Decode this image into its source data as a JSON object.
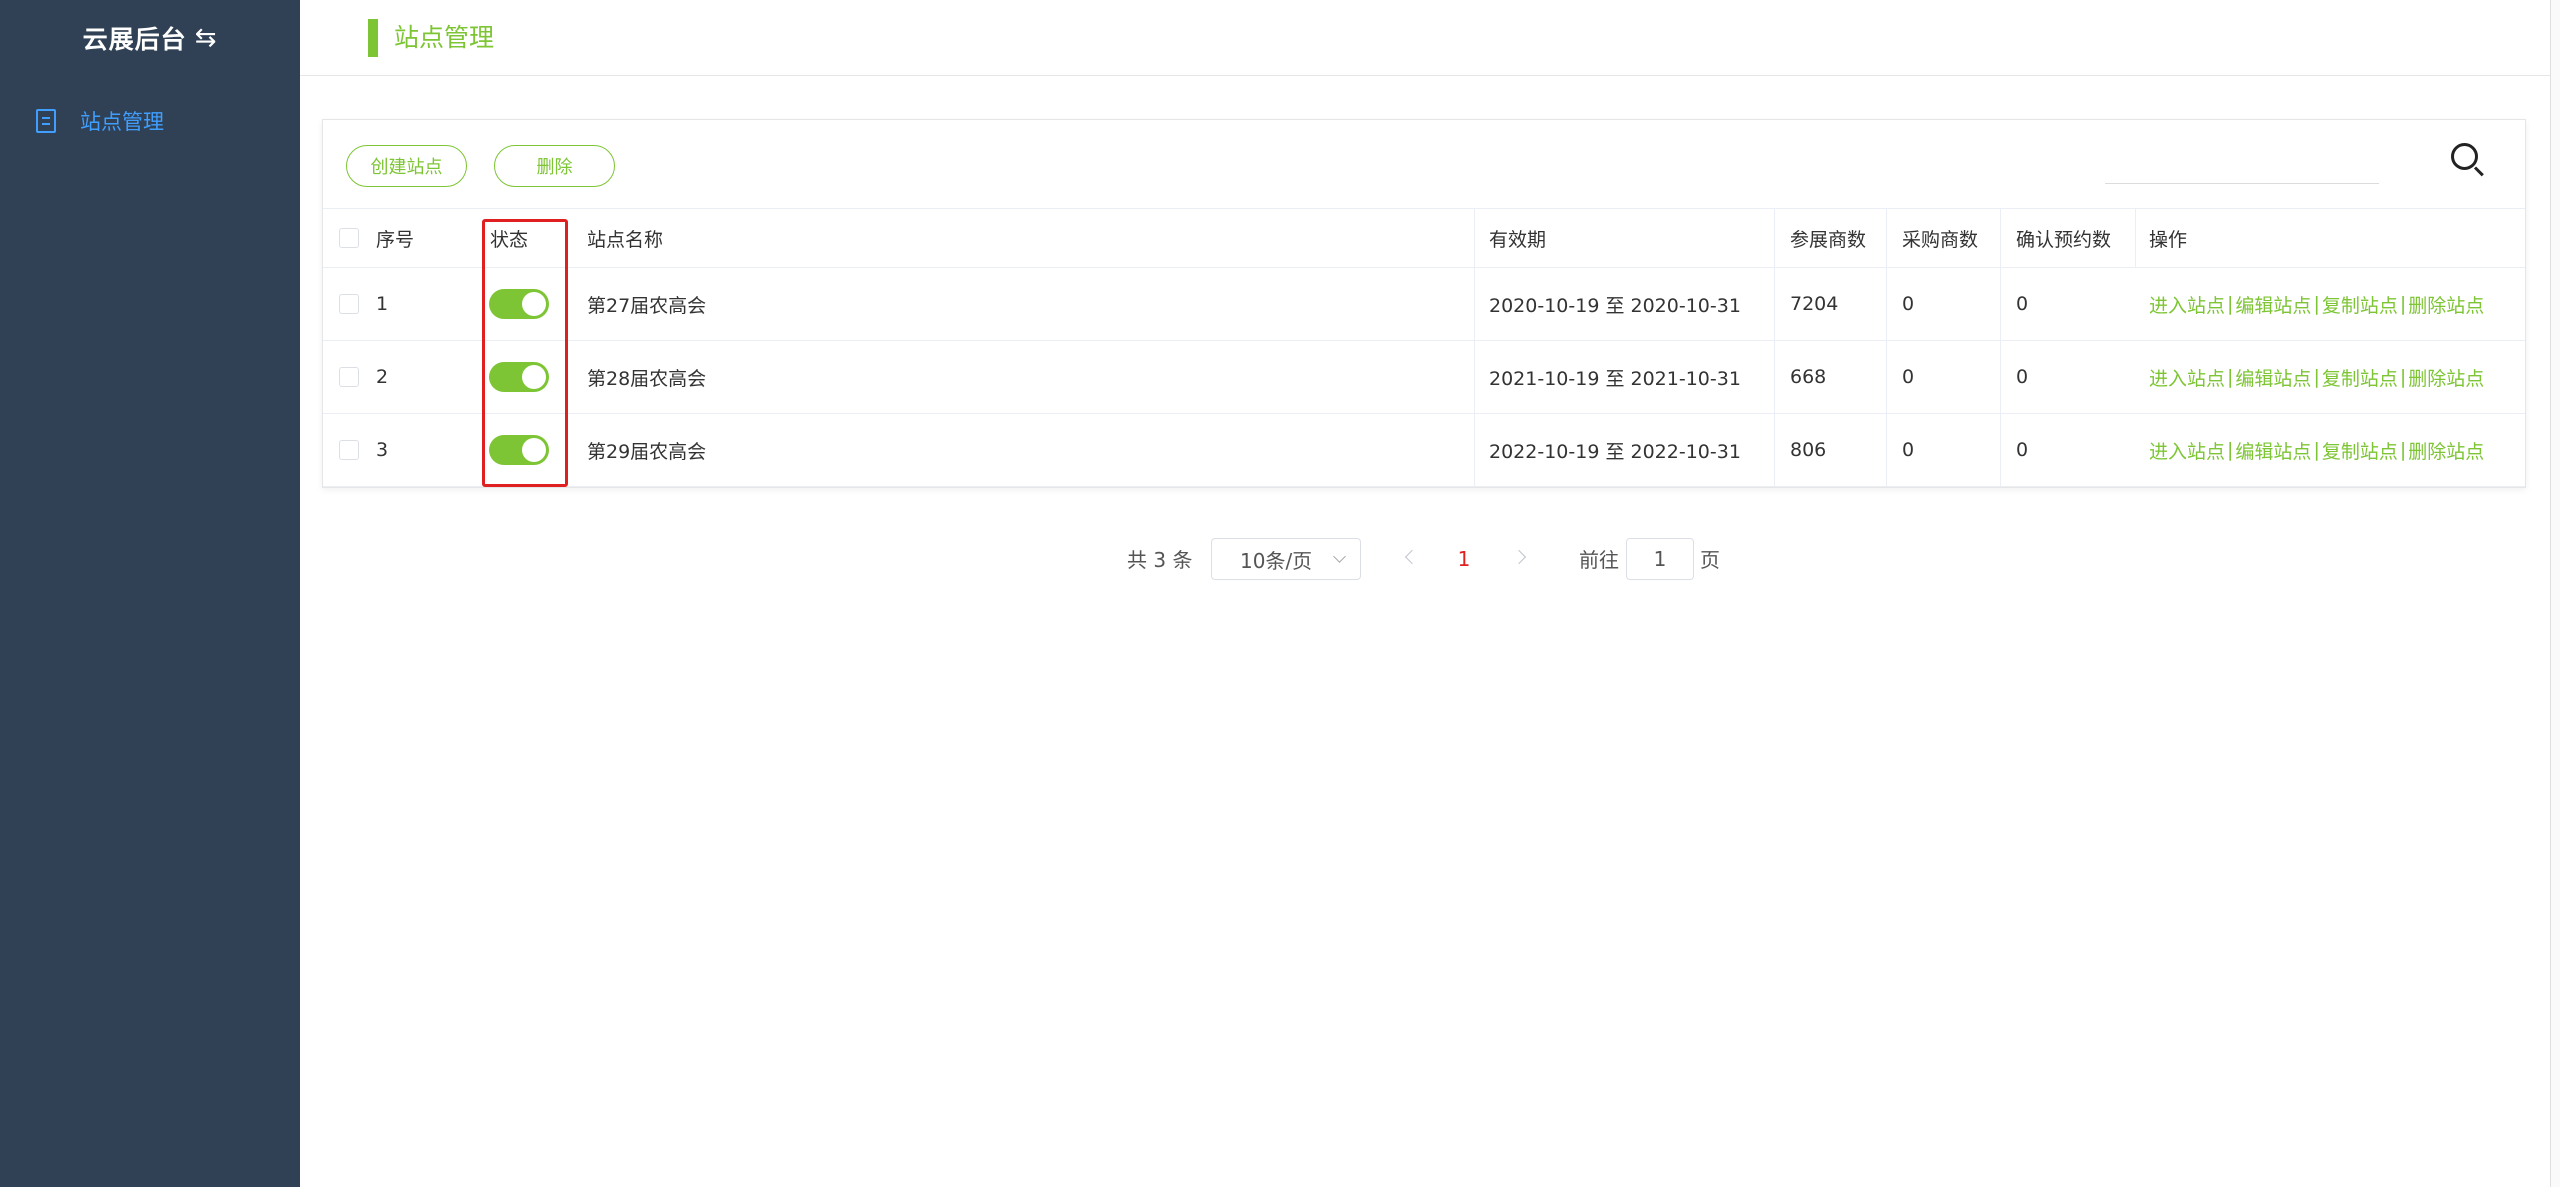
{
  "sidebar": {
    "brand": "云展后台",
    "brand_icon": "swap-arrows-icon",
    "items": [
      {
        "label": "站点管理",
        "icon": "document-icon",
        "active": true
      }
    ]
  },
  "header": {
    "title": "站点管理"
  },
  "toolbar": {
    "create_label": "创建站点",
    "delete_label": "删除",
    "search_placeholder": "",
    "search_icon": "search-icon"
  },
  "table": {
    "headers": {
      "index": "序号",
      "status": "状态",
      "name": "站点名称",
      "validity": "有效期",
      "exhibitors": "参展商数",
      "buyers": "采购商数",
      "reservations": "确认预约数",
      "actions": "操作"
    },
    "rows": [
      {
        "index": "1",
        "status_on": true,
        "name": "第27届农高会",
        "validity": "2020-10-19 至 2020-10-31",
        "exhibitors": "7204",
        "buyers": "0",
        "reservations": "0"
      },
      {
        "index": "2",
        "status_on": true,
        "name": "第28届农高会",
        "validity": "2021-10-19 至 2021-10-31",
        "exhibitors": "668",
        "buyers": "0",
        "reservations": "0"
      },
      {
        "index": "3",
        "status_on": true,
        "name": "第29届农高会",
        "validity": "2022-10-19 至 2022-10-31",
        "exhibitors": "806",
        "buyers": "0",
        "reservations": "0"
      }
    ],
    "actions": {
      "enter": "进入站点",
      "edit": "编辑站点",
      "copy": "复制站点",
      "delete": "删除站点"
    }
  },
  "pagination": {
    "total_text": "共 3 条",
    "page_size": "10条/页",
    "current_page": "1",
    "goto_label": "前往",
    "goto_value": "1",
    "page_unit": "页"
  },
  "colors": {
    "sidebar_bg": "#304156",
    "accent_green": "#7dc534",
    "sidebar_active": "#409EFF",
    "highlight_red": "#e02020"
  }
}
